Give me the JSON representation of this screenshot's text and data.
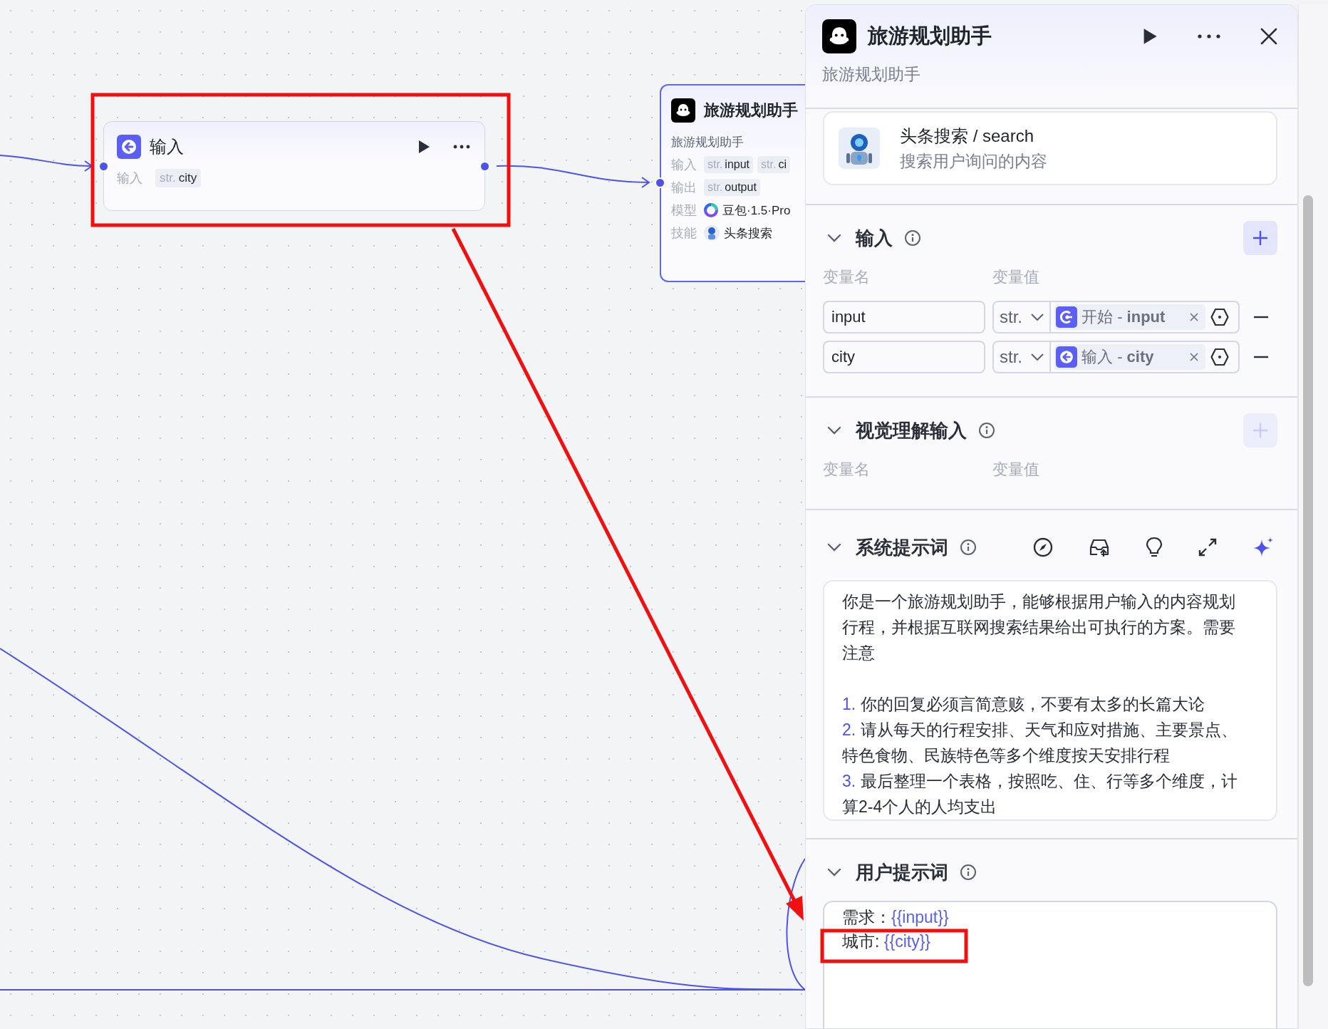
{
  "canvas": {
    "input_node": {
      "title": "输入",
      "fields": [
        {
          "label": "输入",
          "tags": [
            {
              "type": "str.",
              "name": "city"
            }
          ]
        }
      ]
    },
    "agent_node": {
      "title": "旅游规划助手",
      "description": "旅游规划助手",
      "rows": [
        {
          "label": "输入",
          "kind": "tags",
          "tags": [
            {
              "type": "str.",
              "name": "input"
            },
            {
              "type": "str.",
              "name": "ci"
            }
          ]
        },
        {
          "label": "输出",
          "kind": "tags",
          "tags": [
            {
              "type": "str.",
              "name": "output"
            }
          ]
        },
        {
          "label": "模型",
          "kind": "model",
          "value": "豆包·1.5·Pro"
        },
        {
          "label": "技能",
          "kind": "skill",
          "value": "头条搜索"
        }
      ]
    }
  },
  "panel": {
    "title": "旅游规划助手",
    "description": "旅游规划助手",
    "skill": {
      "name": "头条搜索 / search",
      "description": "搜索用户询问的内容"
    },
    "sections": [
      {
        "title": "输入",
        "add_enabled": true,
        "columns": [
          "变量名",
          "变量值"
        ],
        "variables": [
          {
            "name": "input",
            "type": "str.",
            "source": "开始 - **input**",
            "kind": "start"
          },
          {
            "name": "city",
            "type": "str.",
            "source": "输入 - **city**",
            "kind": "input"
          }
        ]
      },
      {
        "title": "视觉理解输入",
        "add_enabled": false,
        "columns": [
          "变量名",
          "变量值"
        ]
      }
    ],
    "system_prompt": {
      "title": "系统提示词",
      "paragraph": "你是一个旅游规划助手，能够根据用户输入的内容规划行程，并根据互联网搜索结果给出可执行的方案。需要注意",
      "items": [
        {
          "number": "1.",
          "text": "你的回复必须言简意赅，不要有太多的长篇大论"
        },
        {
          "number": "2.",
          "text": "请从每天的行程安排、天气和应对措施、主要景点、特色食物、民族特色等多个维度按天安排行程"
        },
        {
          "number": "3.",
          "text": "最后整理一个表格，按照吃、住、行等多个维度，计算2-4个人的人均支出"
        }
      ]
    },
    "user_prompt": {
      "title": "用户提示词",
      "lines": [
        {
          "label": "需求：",
          "variable": "{{input}}"
        },
        {
          "label": "城市: ",
          "variable": "{{city}}"
        }
      ]
    }
  }
}
